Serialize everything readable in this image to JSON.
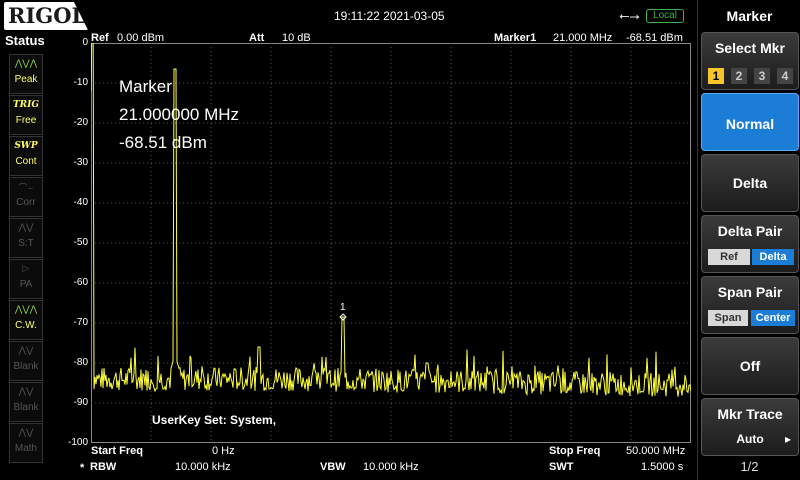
{
  "brand": "RIGOL",
  "datetime": "19:11:22 2021-03-05",
  "local_label": "Local",
  "status": {
    "title": "Status",
    "items": [
      {
        "label": "Peak",
        "italic": false,
        "state": "on",
        "icon": "peak-icon"
      },
      {
        "label": "TRIG\nFree",
        "italic": true,
        "state": "on",
        "icon": "trig-icon"
      },
      {
        "label": "SWP\nCont",
        "italic": true,
        "state": "on",
        "icon": "swp-icon"
      },
      {
        "label": "Corr",
        "italic": false,
        "state": "off",
        "icon": "corr-icon"
      },
      {
        "label": "S:T",
        "italic": false,
        "state": "off",
        "icon": "st-icon"
      },
      {
        "label": "PA",
        "italic": false,
        "state": "off",
        "icon": "pa-icon"
      },
      {
        "label": "C.W.",
        "italic": false,
        "state": "on",
        "icon": "cw-icon"
      },
      {
        "label": "Blank",
        "italic": false,
        "state": "off",
        "icon": "blank-icon"
      },
      {
        "label": "Blank",
        "italic": false,
        "state": "off",
        "icon": "blank-icon"
      },
      {
        "label": "Math",
        "italic": false,
        "state": "off",
        "icon": "math-icon"
      }
    ]
  },
  "header": {
    "ref_label": "Ref",
    "ref_value": "0.00 dBm",
    "att_label": "Att",
    "att_value": "10 dB",
    "marker_label": "Marker1",
    "marker_freq": "21.000 MHz",
    "marker_level": "-68.51 dBm"
  },
  "marker_readout": {
    "title": "Marker",
    "freq": "21.000000 MHz",
    "level": "-68.51 dBm",
    "tag": "1"
  },
  "userkey": "UserKey Set:    System,",
  "footer": {
    "start_label": "Start Freq",
    "start_value": "0 Hz",
    "stop_label": "Stop Freq",
    "stop_value": "50.000 MHz",
    "rbw_star": "*",
    "rbw_label": "RBW",
    "rbw_value": "10.000 kHz",
    "vbw_label": "VBW",
    "vbw_value": "10.000 kHz",
    "swt_label": "SWT",
    "swt_value": "1.5000 s"
  },
  "menu": {
    "title": "Marker",
    "select_mkr": {
      "label": "Select Mkr",
      "options": [
        "1",
        "2",
        "3",
        "4"
      ],
      "active": "1"
    },
    "normal": "Normal",
    "delta": "Delta",
    "delta_pair": {
      "label": "Delta Pair",
      "options": [
        "Ref",
        "Delta"
      ],
      "active": "Delta"
    },
    "span_pair": {
      "label": "Span Pair",
      "options": [
        "Span",
        "Center"
      ],
      "active": "Center"
    },
    "off": "Off",
    "mkr_trace": {
      "label": "Mkr Trace",
      "value": "Auto"
    },
    "page": "1/2"
  },
  "colors": {
    "trace": "#ffff3c",
    "grid": "#555555",
    "selected": "#1b7dd6",
    "marker_active": "#f5c52a"
  },
  "chart_data": {
    "type": "line",
    "title": "",
    "xlabel": "",
    "ylabel": "",
    "xlim": [
      0,
      50
    ],
    "ylim": [
      -100,
      0
    ],
    "x_unit": "MHz",
    "y_unit": "dBm",
    "yticks": [
      0,
      -10,
      -20,
      -30,
      -40,
      -50,
      -60,
      -70,
      -80,
      -90,
      -100
    ],
    "grid": true,
    "series": [
      {
        "noise_floor": -84,
        "peaks": [
          {
            "x": 0.0,
            "y": -12
          },
          {
            "x": 7.0,
            "y": -6.5
          },
          {
            "x": 14.0,
            "y": -76
          },
          {
            "x": 21.0,
            "y": -68.51
          },
          {
            "x": 28.0,
            "y": -80
          }
        ]
      }
    ],
    "markers": [
      {
        "id": "1",
        "x": 21.0,
        "y": -68.51
      }
    ]
  }
}
